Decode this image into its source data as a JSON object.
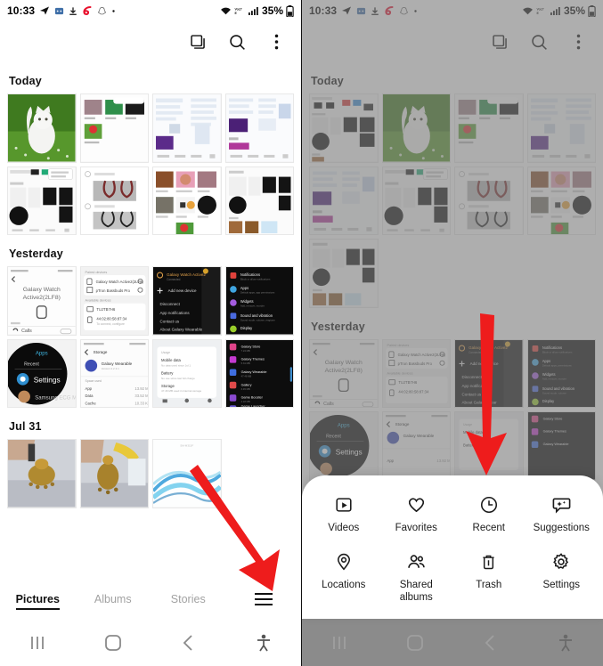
{
  "meta": {
    "accent_red": "#ee1c1c",
    "dim_color": "rgba(125,125,125,0.62)"
  },
  "status_bar": {
    "time": "10:33",
    "battery": "35%",
    "icons": [
      "telegram-icon",
      "message-icon",
      "download-icon",
      "airtel-icon",
      "snapchat-icon",
      "dot-icon"
    ],
    "right_icons": [
      "wifi-icon",
      "volte-icon",
      "signal-icon",
      "battery-icon"
    ]
  },
  "app_bar": {
    "multi_select_label": "multi-select",
    "search_label": "search",
    "more_label": "more options"
  },
  "sections": [
    {
      "title": "Today",
      "count": 8
    },
    {
      "title": "Yesterday",
      "count": 8
    },
    {
      "title": "Jul 31",
      "count": 3
    }
  ],
  "right_sections": [
    {
      "title": "Today",
      "count": 9
    },
    {
      "title": "Yesterday",
      "count": 8
    }
  ],
  "tabs": [
    {
      "label": "Pictures",
      "active": true
    },
    {
      "label": "Albums",
      "active": false
    },
    {
      "label": "Stories",
      "active": false
    }
  ],
  "tab_menu_icon": "hamburger-icon",
  "nav_bar": {
    "recents": "recents-icon",
    "home": "home-icon",
    "back": "back-icon",
    "accessibility": "accessibility-icon"
  },
  "sheet": {
    "items": [
      {
        "label": "Videos",
        "icon": "video-icon"
      },
      {
        "label": "Favorites",
        "icon": "heart-icon"
      },
      {
        "label": "Recent",
        "icon": "clock-icon"
      },
      {
        "label": "Suggestions",
        "icon": "suggestion-bubble-icon"
      },
      {
        "label": "Locations",
        "icon": "location-pin-icon"
      },
      {
        "label": "Shared\nalbums",
        "icon": "people-icon"
      },
      {
        "label": "Trash",
        "icon": "trash-icon"
      },
      {
        "label": "Settings",
        "icon": "gear-icon"
      }
    ]
  },
  "annotations": [
    {
      "name": "arrow-to-hamburger",
      "panel": "left",
      "points_to": "hamburger-icon"
    },
    {
      "name": "arrow-to-recent",
      "panel": "right",
      "points_to": "Recent"
    }
  ]
}
